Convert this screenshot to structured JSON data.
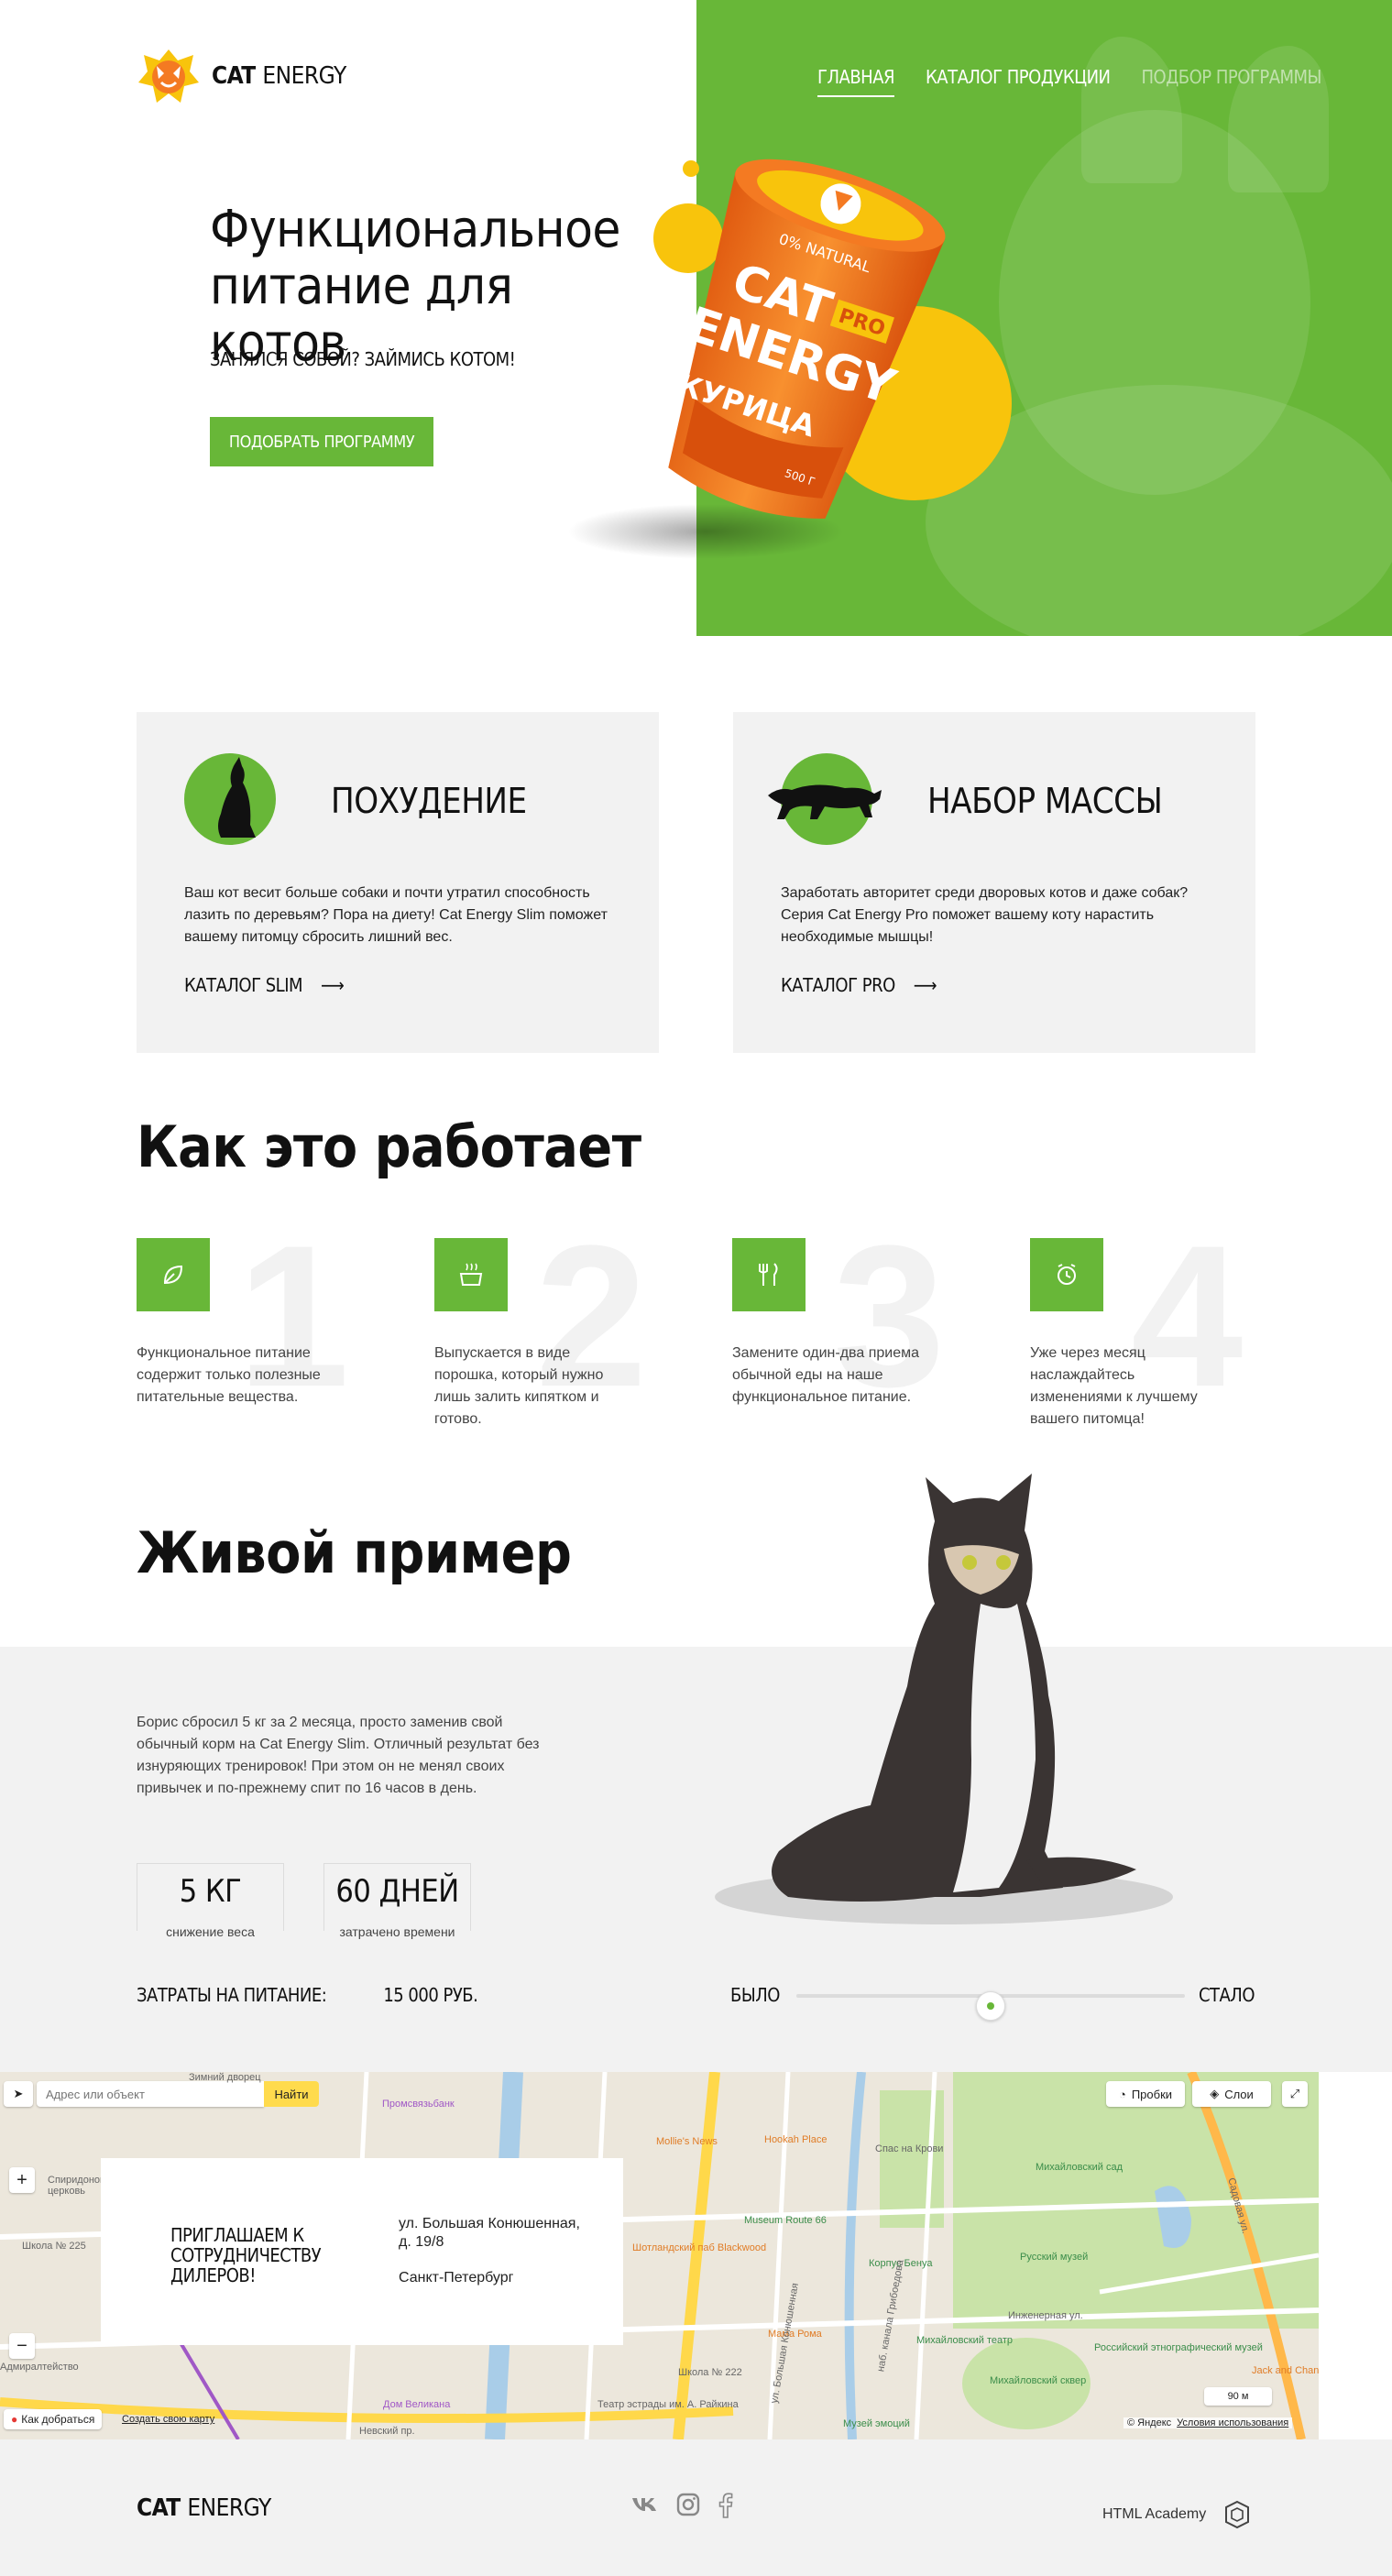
{
  "brand": {
    "logo_strong": "CAT",
    "logo_light": "ENERGY",
    "accent": "#68b738",
    "yellow": "#f8c40c",
    "orange": "#f47a22"
  },
  "nav": {
    "items": [
      {
        "label": "ГЛАВНАЯ",
        "state": "active"
      },
      {
        "label": "КАТАЛОГ ПРОДУКЦИИ",
        "state": "normal"
      },
      {
        "label": "ПОДБОР ПРОГРАММЫ",
        "state": "dim"
      }
    ]
  },
  "hero": {
    "title_line1": "Функциональное",
    "title_line2": "питание для котов",
    "subtitle": "ЗАНЯЛСЯ СОБОЙ? ЗАЙМИСЬ КОТОМ!",
    "button": "ПОДОБРАТЬ ПРОГРАММУ",
    "product": {
      "brand_line1": "CAT",
      "brand_line2": "ENERGY",
      "badge": "PRO",
      "flavor": "КУРИЦА",
      "natural": "0% NATURAL",
      "weight": "500 Г"
    }
  },
  "cards": [
    {
      "title": "ПОХУДЕНИЕ",
      "icon": "slim-cat-icon",
      "text": "Ваш кот весит больше собаки и почти утратил способность лазить по деревьям? Пора на диету! Cat Energy Slim поможет вашему питомцу сбросить лишний вес.",
      "link": "КАТАЛОГ SLIM"
    },
    {
      "title": "НАБОР МАССЫ",
      "icon": "panther-icon",
      "text": "Заработать авторитет среди дворовых котов и даже собак? Серия Cat Energy Pro поможет вашему коту нарастить необходимые мышцы!",
      "link": "КАТАЛОГ PRO"
    }
  ],
  "how": {
    "title": "Как это работает",
    "steps": [
      {
        "num": "1",
        "icon": "leaf-icon",
        "text": "Функциональное питание содержит только полезные питательные вещества."
      },
      {
        "num": "2",
        "icon": "bowl-icon",
        "text": "Выпускается в виде порошка, который нужно лишь залить кипятком и готово."
      },
      {
        "num": "3",
        "icon": "cutlery-icon",
        "text": "Замените один-два приема обычной еды на наше функциональное питание."
      },
      {
        "num": "4",
        "icon": "alarm-clock-icon",
        "text": "Уже через месяц наслаждайтесь изменениями к лучшему вашего питомца!"
      }
    ]
  },
  "live": {
    "title": "Живой пример",
    "text": "Борис сбросил 5 кг за 2 месяца, просто заменив свой обычный корм на Cat Energy Slim. Отличный результат без изнуряющих тренировок! При этом он не менял своих привычек и по-прежнему спит по 16 часов в день.",
    "stats": [
      {
        "value": "5 КГ",
        "label": "снижение веса"
      },
      {
        "value": "60 ДНЕЙ",
        "label": "затрачено времени"
      }
    ],
    "costs_label": "ЗАТРАТЫ НА ПИТАНИЕ:",
    "costs_value": "15 000 РУБ.",
    "before": "БЫЛО",
    "after": "СТАЛО",
    "slider_position": 0.5
  },
  "map": {
    "search_placeholder": "Адрес или объект",
    "find": "Найти",
    "traffic": "Пробки",
    "layers": "Слои",
    "route": "Как добраться",
    "create": "Создать свою карту",
    "copyright": "© Яндекс",
    "terms": "Условия использования",
    "scale": "90 м",
    "labels": [
      {
        "text": "Зимний дворец",
        "cls": ""
      },
      {
        "text": "Спас на Крови",
        "cls": ""
      },
      {
        "text": "Михайловский сад",
        "cls": "green"
      },
      {
        "text": "Русский музей",
        "cls": "green"
      },
      {
        "text": "Михайловский театр",
        "cls": "green"
      },
      {
        "text": "Михайловский сквер",
        "cls": "green"
      },
      {
        "text": "Российский этнографический музей",
        "cls": "green"
      },
      {
        "text": "Музей эмоций",
        "cls": "green"
      },
      {
        "text": "Museum Route 66",
        "cls": "green"
      },
      {
        "text": "Корпус Бенуа",
        "cls": "green"
      },
      {
        "text": "Mollie's News",
        "cls": "orange"
      },
      {
        "text": "Hookah Place",
        "cls": "orange"
      },
      {
        "text": "Мама Рома",
        "cls": "orange"
      },
      {
        "text": "Шотландский паб Blackwood",
        "cls": "orange"
      },
      {
        "text": "Jack and Chan",
        "cls": "orange"
      },
      {
        "text": "Промсвязьбанк",
        "cls": "purple"
      },
      {
        "text": "Дом Великана",
        "cls": "purple"
      },
      {
        "text": "Невский пр.",
        "cls": ""
      },
      {
        "text": "Инженерная ул.",
        "cls": ""
      },
      {
        "text": "Садовая ул.",
        "cls": ""
      },
      {
        "text": "наб. канала Грибоедова",
        "cls": ""
      },
      {
        "text": "ул. Большая Конюшенная",
        "cls": ""
      },
      {
        "text": "Театр эстрады им. А. Райкина",
        "cls": ""
      },
      {
        "text": "Школа № 222",
        "cls": ""
      },
      {
        "text": "Школа № 225",
        "cls": ""
      },
      {
        "text": "Спиридоновская церковь",
        "cls": ""
      },
      {
        "text": "Адмиралтейство",
        "cls": ""
      }
    ]
  },
  "dealer": {
    "title": "ПРИГЛАШАЕМ К СОТРУДНИЧЕСТВУ ДИЛЕРОВ!",
    "address": "ул. Большая Конюшенная, д. 19/8",
    "city": "Санкт-Петербург"
  },
  "footer": {
    "logo_strong": "CAT",
    "logo_light": "ENERGY",
    "academy": "HTML Academy",
    "socials": [
      "vk-icon",
      "instagram-icon",
      "facebook-icon"
    ]
  }
}
